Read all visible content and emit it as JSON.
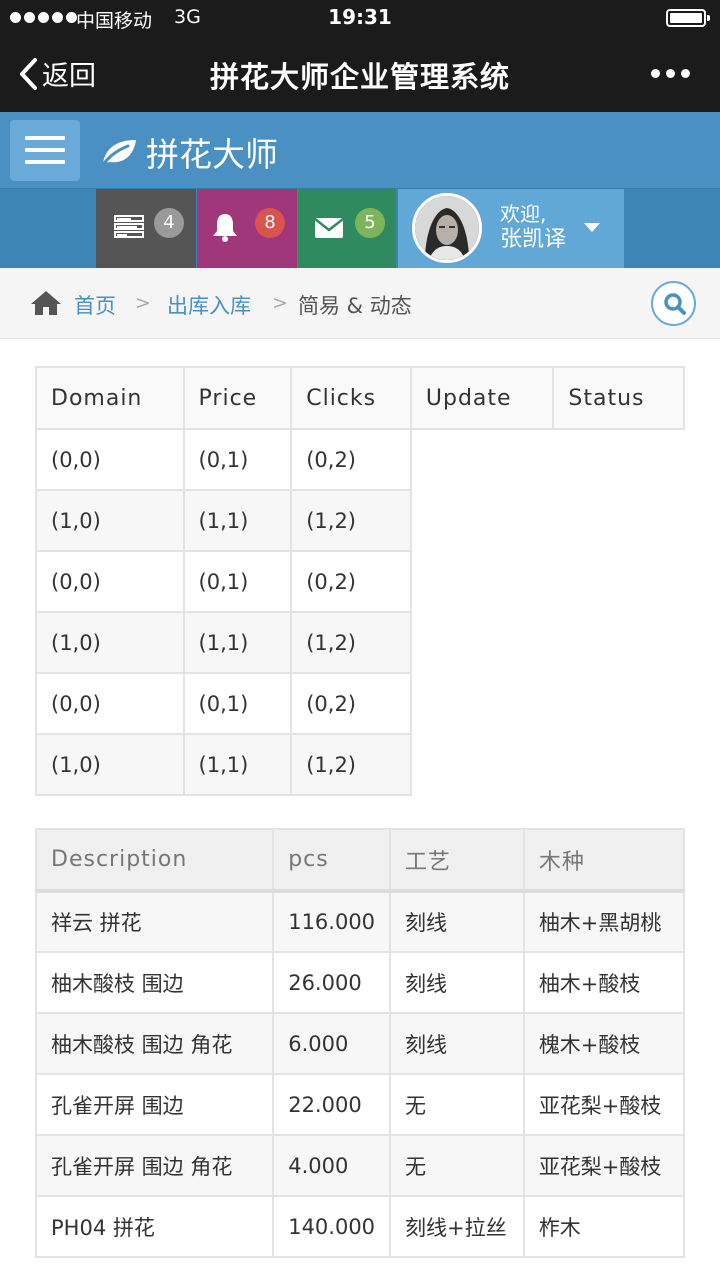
{
  "status_bar": {
    "carrier": "中国移动",
    "network": "3G",
    "time": "19:31"
  },
  "nav": {
    "back_label": "返回",
    "title": "拼花大师企业管理系统"
  },
  "app": {
    "brand": "拼花大师"
  },
  "toolbar": {
    "tasks_count": "4",
    "notifications_count": "8",
    "messages_count": "5",
    "welcome": "欢迎,",
    "user_name": "张凯译"
  },
  "breadcrumb": {
    "home": "首页",
    "section": "出库入库",
    "current": "简易 & 动态"
  },
  "table1": {
    "headers": [
      "Domain",
      "Price",
      "Clicks",
      "Update",
      "Status"
    ],
    "rows": [
      [
        "(0,0)",
        "(0,1)",
        "(0,2)"
      ],
      [
        "(1,0)",
        "(1,1)",
        "(1,2)"
      ],
      [
        "(0,0)",
        "(0,1)",
        "(0,2)"
      ],
      [
        "(1,0)",
        "(1,1)",
        "(1,2)"
      ],
      [
        "(0,0)",
        "(0,1)",
        "(0,2)"
      ],
      [
        "(1,0)",
        "(1,1)",
        "(1,2)"
      ]
    ]
  },
  "table2": {
    "headers": [
      "Description",
      "pcs",
      "工艺",
      "木种"
    ],
    "rows": [
      [
        "祥云 拼花",
        "116.000",
        "刻线",
        "柚木+黑胡桃"
      ],
      [
        "柚木酸枝 围边",
        "26.000",
        "刻线",
        "柚木+酸枝"
      ],
      [
        "柚木酸枝 围边 角花",
        "6.000",
        "刻线",
        "槐木+酸枝"
      ],
      [
        "孔雀开屏 围边",
        "22.000",
        "无",
        "亚花梨+酸枝"
      ],
      [
        "孔雀开屏 围边 角花",
        "4.000",
        "无",
        "亚花梨+酸枝"
      ],
      [
        "PH04 拼花",
        "140.000",
        "刻线+拉丝",
        "柞木"
      ]
    ]
  },
  "colors": {
    "app_header": "#4a90c2",
    "tasks": "#555555",
    "notifications": "#a0377a",
    "messages": "#2f8b5f",
    "user": "#62a8d6"
  }
}
